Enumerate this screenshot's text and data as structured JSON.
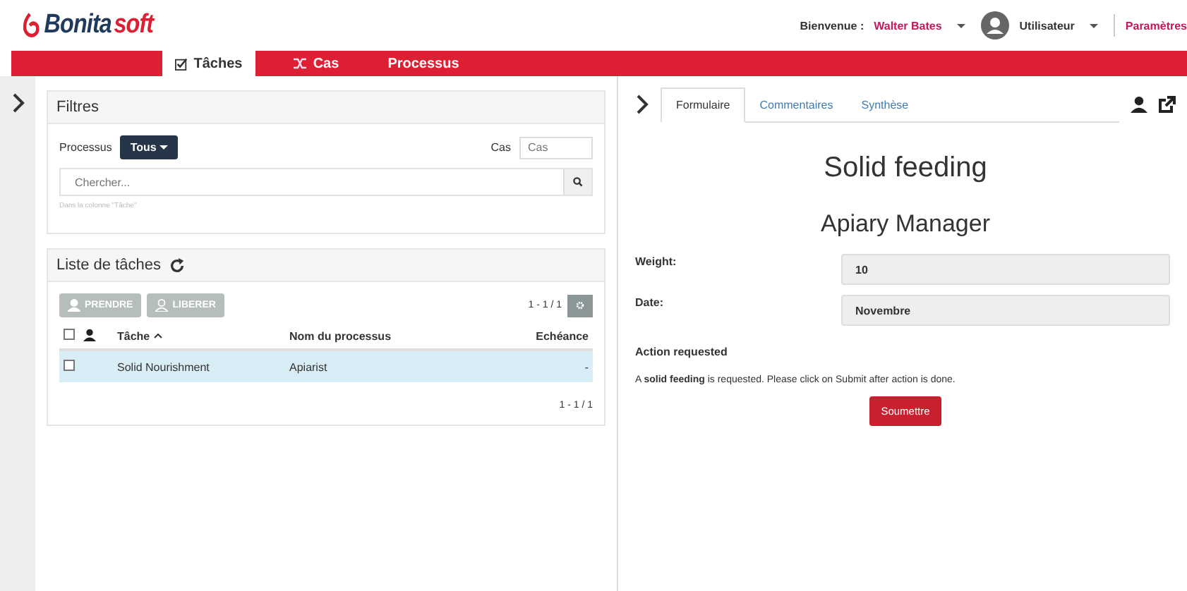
{
  "header": {
    "logo": {
      "prefix": "Bonita",
      "suffix": "soft"
    },
    "welcome_label": "Bienvenue :",
    "user_name": "Walter Bates",
    "profile": "Utilisateur",
    "settings": "Paramètres"
  },
  "nav_tabs": [
    {
      "label": "Tâches",
      "selected": true
    },
    {
      "label": "Cas",
      "selected": false
    },
    {
      "label": "Processus",
      "selected": false
    }
  ],
  "filters": {
    "title": "Filtres",
    "process_label": "Processus",
    "process_value": "Tous",
    "case_label": "Cas",
    "case_placeholder": "Cas",
    "search_placeholder": "Chercher...",
    "search_hint": "Dans la colonne \"Tâche\""
  },
  "task_list": {
    "title": "Liste de tâches",
    "actions": [
      {
        "label": "PRENDRE",
        "disabled": true
      },
      {
        "label": "LIBERER",
        "disabled": true
      }
    ],
    "pagination_top": "1 - 1 / 1",
    "pagination_bottom": "1 - 1 / 1",
    "columns": [
      "Tâche",
      "Nom du processus",
      "Echéance"
    ],
    "select_all_checked": false,
    "rows": [
      {
        "task": "Solid Nourishment",
        "process": "Apiarist",
        "due": "-",
        "checked": false,
        "selected": true
      }
    ]
  },
  "detail": {
    "tabs": [
      {
        "label": "Formulaire",
        "selected": true
      },
      {
        "label": "Commentaires",
        "selected": false
      },
      {
        "label": "Synthèse",
        "selected": false
      }
    ],
    "title": "Solid feeding",
    "subtitle": "Apiary Manager",
    "fields": [
      {
        "label": "Weight:",
        "value": "10"
      },
      {
        "label": "Date:",
        "value": "Novembre"
      }
    ],
    "section": "Action requested",
    "message": "A **solid feeding** is requested. Please click on Submit after action is done.",
    "submit": "Soumettre"
  }
}
